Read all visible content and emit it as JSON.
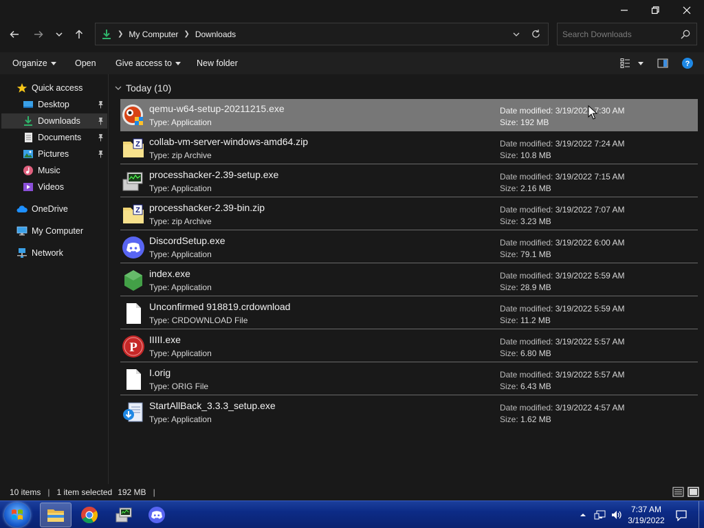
{
  "window": {
    "controls": [
      "minimize",
      "maximize",
      "close"
    ]
  },
  "nav": {
    "breadcrumbs": [
      "My Computer",
      "Downloads"
    ],
    "search_placeholder": "Search Downloads"
  },
  "toolbar": {
    "organize": "Organize",
    "open": "Open",
    "give_access": "Give access to",
    "new_folder": "New folder"
  },
  "sidebar": {
    "items": [
      {
        "label": "Quick access",
        "icon": "star-icon"
      },
      {
        "label": "Desktop",
        "icon": "desktop-icon",
        "pinned": true
      },
      {
        "label": "Downloads",
        "icon": "download-icon",
        "pinned": true,
        "active": true
      },
      {
        "label": "Documents",
        "icon": "documents-icon",
        "pinned": true
      },
      {
        "label": "Pictures",
        "icon": "pictures-icon",
        "pinned": true
      },
      {
        "label": "Music",
        "icon": "music-icon"
      },
      {
        "label": "Videos",
        "icon": "videos-icon"
      },
      {
        "label": "OneDrive",
        "icon": "cloud-icon"
      },
      {
        "label": "My Computer",
        "icon": "computer-icon"
      },
      {
        "label": "Network",
        "icon": "network-icon"
      }
    ]
  },
  "group": {
    "title": "Today (10)"
  },
  "labels": {
    "date_modified": "Date modified:",
    "size": "Size:",
    "type": "Type:"
  },
  "files": [
    {
      "name": "qemu-w64-setup-20211215.exe",
      "type": "Application",
      "date": "3/19/2022 7:30 AM",
      "size": "192 MB",
      "icon": "qemu-icon",
      "selected": true
    },
    {
      "name": "collab-vm-server-windows-amd64.zip",
      "type": "zip Archive",
      "date": "3/19/2022 7:24 AM",
      "size": "10.8 MB",
      "icon": "zip-icon"
    },
    {
      "name": "processhacker-2.39-setup.exe",
      "type": "Application",
      "date": "3/19/2022 7:15 AM",
      "size": "2.16 MB",
      "icon": "processhacker-icon"
    },
    {
      "name": "processhacker-2.39-bin.zip",
      "type": "zip Archive",
      "date": "3/19/2022 7:07 AM",
      "size": "3.23 MB",
      "icon": "zip-icon"
    },
    {
      "name": "DiscordSetup.exe",
      "type": "Application",
      "date": "3/19/2022 6:00 AM",
      "size": "79.1 MB",
      "icon": "discord-icon"
    },
    {
      "name": "index.exe",
      "type": "Application",
      "date": "3/19/2022 5:59 AM",
      "size": "28.9 MB",
      "icon": "node-icon"
    },
    {
      "name": "Unconfirmed 918819.crdownload",
      "type": "CRDOWNLOAD File",
      "date": "3/19/2022 5:59 AM",
      "size": "11.2 MB",
      "icon": "file-icon"
    },
    {
      "name": "IIIII.exe",
      "type": "Application",
      "date": "3/19/2022 5:57 AM",
      "size": "6.80 MB",
      "icon": "psiphon-icon"
    },
    {
      "name": "I.orig",
      "type": "ORIG File",
      "date": "3/19/2022 5:57 AM",
      "size": "6.43 MB",
      "icon": "file-icon"
    },
    {
      "name": "StartAllBack_3.3.3_setup.exe",
      "type": "Application",
      "date": "3/19/2022 4:57 AM",
      "size": "1.62 MB",
      "icon": "installer-icon"
    }
  ],
  "status": {
    "items_count": "10 items",
    "selection": "1 item selected",
    "selection_size": "192 MB"
  },
  "taskbar": {
    "apps": [
      "explorer-icon",
      "chrome-icon",
      "processhacker-icon",
      "discord-icon"
    ],
    "time": "7:37 AM",
    "date": "3/19/2022"
  },
  "colors": {
    "background": "#191919",
    "selected_row": "#777777",
    "accent": "#1e90ff",
    "taskbar": "#0c2b86"
  }
}
